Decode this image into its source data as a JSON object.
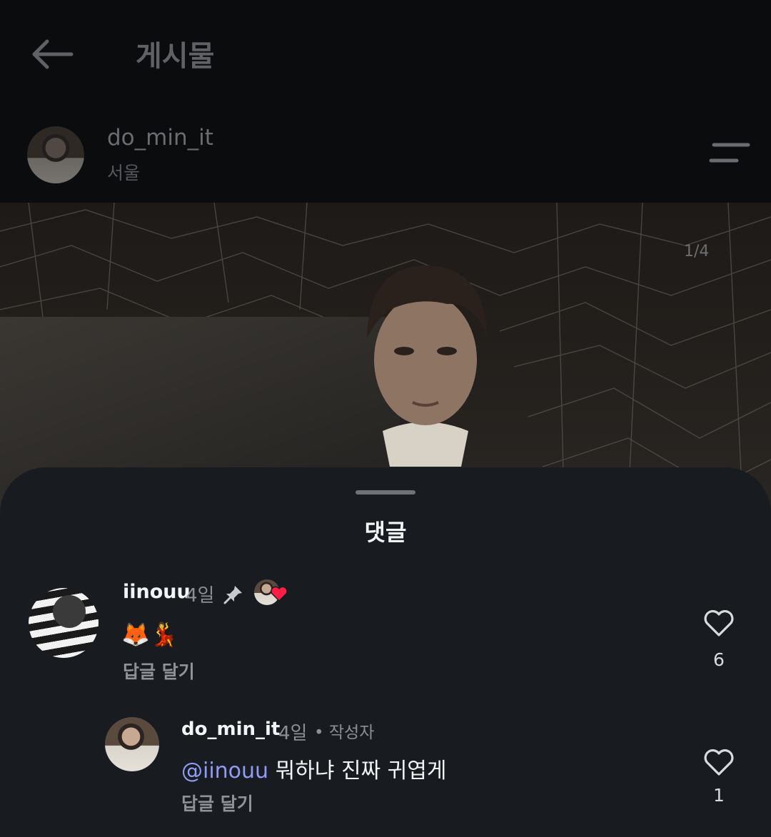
{
  "header": {
    "title": "게시물",
    "back_icon": "arrow-left-icon"
  },
  "post": {
    "author": {
      "username": "do_min_it",
      "location": "서울",
      "avatar_icon": "profile-photo"
    },
    "menu_icon": "menu-icon",
    "page_indicator": "1/4"
  },
  "comments_sheet": {
    "title": "댓글",
    "comments": [
      {
        "username": "iinouu",
        "time": "4일",
        "pinned": true,
        "liked_by_author": true,
        "text": "🦊💃",
        "reply_label": "답글 달기",
        "likes": "6"
      },
      {
        "username": "do_min_it",
        "time": "4일",
        "author_badge": "• 작성자",
        "mention": "@iinouu",
        "text": " 뭐하냐 진짜 귀엽게",
        "reply_label": "답글 달기",
        "likes": "1"
      }
    ]
  },
  "colors": {
    "sheet_background": "#181b1f",
    "page_background": "#0b0c0e",
    "mention": "#8f9cf5",
    "heart_badge": "#ff1d48"
  }
}
